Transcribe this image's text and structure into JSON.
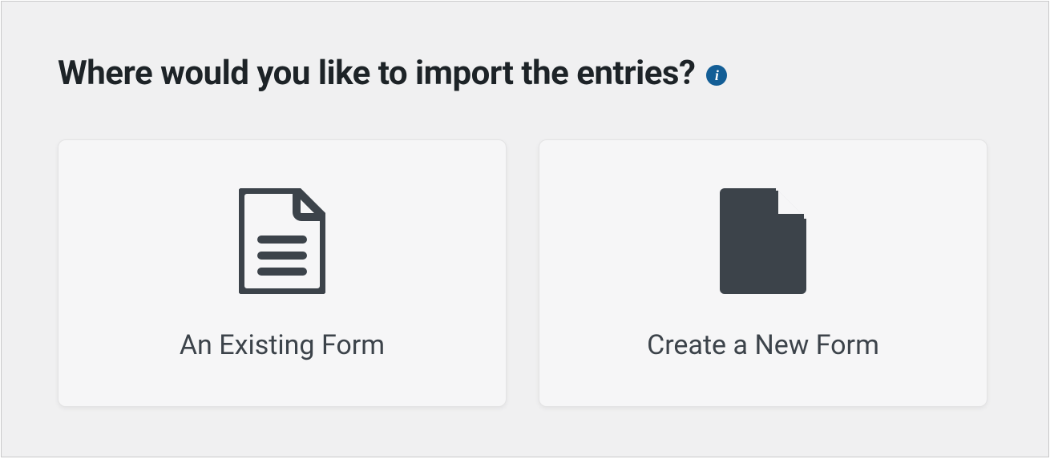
{
  "heading": "Where would you like to import the entries?",
  "info_glyph": "i",
  "options": {
    "existing": {
      "label": "An Existing Form",
      "icon": "document-lines-icon"
    },
    "new": {
      "label": "Create a New Form",
      "icon": "document-blank-icon"
    }
  },
  "colors": {
    "icon": "#3c434a",
    "panel_bg": "#f0f0f1",
    "info_bg": "#135e96"
  }
}
